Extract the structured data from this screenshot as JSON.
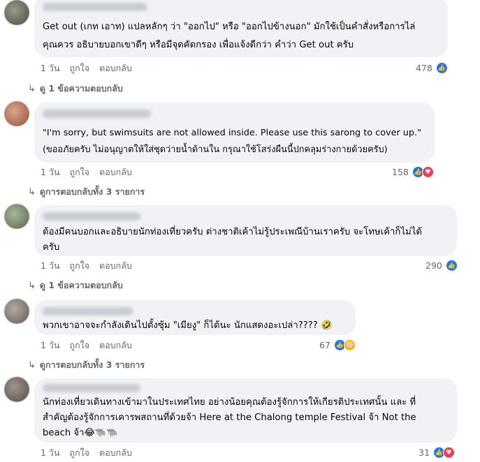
{
  "comments": [
    {
      "text_lines": [
        "Get out (เกท เอาท) แปลหลักๆ ว่า \"ออกไป\" หรือ \"ออกไปข้างนอก\" มักใช้เป็นคำสั่งหรือการไล่",
        "คุณควร อธิบายบอกเขาดีๆ หรือมีจุดคัดกรอง เพื่อแจ้งดีกว่า คำว่า Get out ครับ"
      ],
      "time": "1 วัน",
      "like": "ถูกใจ",
      "reply": "ตอบกลับ",
      "reaction_count": "478",
      "replies_label": "ดู 1 ข้อความตอบกลับ"
    },
    {
      "text_lines": [
        "\"I'm sorry, but swimsuits are not allowed inside. Please use this sarong to cover up.\"",
        "(ขออภัยครับ ไม่อนุญาตให้ใส่ชุดว่ายน้ำด้านใน กรุณาใช้โสร่งผืนนี้ปกคลุมร่างกายด้วยครับ)"
      ],
      "time": "1 วัน",
      "like": "ถูกใจ",
      "reply": "ตอบกลับ",
      "reaction_count": "158",
      "replies_label": "ดูการตอบกลับทั้ง 3 รายการ"
    },
    {
      "text_lines": [
        "ต้องมีคนบอกและอธิบายนักท่องเที่ยวครับ ต่างชาติเค้าไม่รู้ประเพณีบ้านเราครับ จะโทษเค้าก็ไม่ได้",
        "ครับ"
      ],
      "time": "1 วัน",
      "like": "ถูกใจ",
      "reply": "ตอบกลับ",
      "reaction_count": "290",
      "replies_label": "ดู 1 ข้อความตอบกลับ"
    },
    {
      "text_lines": [
        "พวกเขาอาจจะกำลังเดินไปตั้งซุ้ม \"เมียงู\" ก็ได้นะ นักแสดงอะเปล่า???? 🤣"
      ],
      "time": "1 วัน",
      "like": "ถูกใจ",
      "reply": "ตอบกลับ",
      "reaction_count": "67",
      "replies_label": "ดูการตอบกลับทั้ง 3 รายการ"
    },
    {
      "text_lines": [
        "นักท่องเที่ยวเดินทางเข้ามาในประเทศไทย อย่างน้อยคุณต้องรู้จักการให้เกียรติประเทศนั้น และ ที่",
        "สำคัญต้องรู้จักการเคารพสถานที่ด้วยจ้า Here at the Chalong temple Festival จ้า Not the",
        "beach จ้า😂🐃🐃"
      ],
      "time": "1 วัน",
      "like": "ถูกใจ",
      "reply": "ตอบกลับ",
      "reaction_count": "31"
    }
  ],
  "colors": {
    "bubble": "#f0f2f5",
    "meta_text": "#65676b",
    "like_blue": "#1877f2",
    "love_red": "#f33e58",
    "haha_yellow": "#f7b125"
  },
  "icons": {
    "like": "thumbs-up-icon",
    "love": "heart-icon",
    "haha": "laughing-face-icon",
    "reply_arrow": "reply-arrow-icon"
  }
}
